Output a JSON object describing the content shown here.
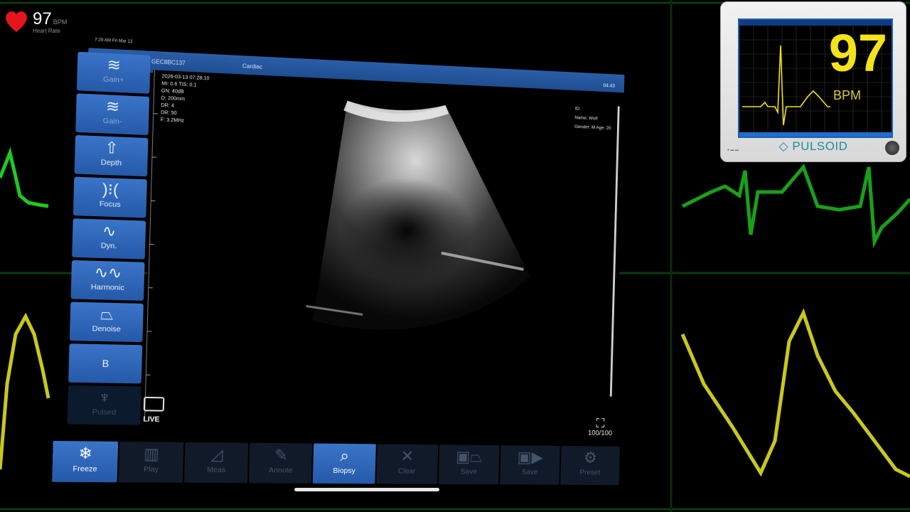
{
  "overlay": {
    "heart_rate_value": "97",
    "heart_rate_unit": "BPM",
    "heart_rate_label": "Heart Rate"
  },
  "tablet": {
    "statusbar_text": "7:29 AM  Fri Mar 13",
    "device_name": "SS-1S GEC8BC137",
    "exam_mode": "Cardiac",
    "status_icons": "04:43",
    "info_lines": [
      "2026-03-13 07:28:10",
      "MI: 0.6  TIS: 0.1",
      "GN: 40dB",
      "D: 200mm",
      "DR: 4",
      "DR: 50",
      "F: 3.2MHz"
    ],
    "patient_lines": [
      "ID:",
      "Name: Wolf",
      "Gender: M     Age: 20"
    ],
    "live_label": "LIVE",
    "fullscreen_value": "100/100",
    "side_buttons": [
      {
        "label": "Gain+",
        "icon": "gain-up-icon",
        "state": "dim-label"
      },
      {
        "label": "Gain-",
        "icon": "gain-down-icon",
        "state": "dim-label"
      },
      {
        "label": "Depth",
        "icon": "depth-icon",
        "state": "active"
      },
      {
        "label": "Focus",
        "icon": "focus-icon",
        "state": "active"
      },
      {
        "label": "Dyn.",
        "icon": "dynamic-range-icon",
        "state": "active"
      },
      {
        "label": "Harmonic",
        "icon": "harmonic-icon",
        "state": "active"
      },
      {
        "label": "Denoise",
        "icon": "denoise-icon",
        "state": "active"
      },
      {
        "label": "B",
        "icon": "b-mode-icon",
        "state": "active"
      },
      {
        "label": "Pulsed",
        "icon": "pulsed-icon",
        "state": "disabled"
      }
    ],
    "bottom_buttons": [
      {
        "label": "Freeze",
        "icon": "snowflake-icon",
        "state": "on"
      },
      {
        "label": "Play",
        "icon": "film-icon",
        "state": "off"
      },
      {
        "label": "Meas",
        "icon": "ruler-icon",
        "state": "off"
      },
      {
        "label": "Annote",
        "icon": "annotate-icon",
        "state": "off"
      },
      {
        "label": "Biopsy",
        "icon": "biopsy-icon",
        "state": "on"
      },
      {
        "label": "Clear",
        "icon": "clear-x-icon",
        "state": "off"
      },
      {
        "label": "Save",
        "icon": "save-image-icon",
        "state": "off"
      },
      {
        "label": "Save",
        "icon": "save-video-icon",
        "state": "off"
      },
      {
        "label": "Preset",
        "icon": "gear-icon",
        "state": "off"
      }
    ]
  },
  "monitor": {
    "value": "97",
    "unit": "BPM",
    "brand": "PULSOID"
  },
  "colors": {
    "ecg_green": "#1fc81f",
    "ecg_yellow": "#c8c81e",
    "monitor_yellow": "#f4e21a",
    "button_blue": "#2f68b8"
  }
}
